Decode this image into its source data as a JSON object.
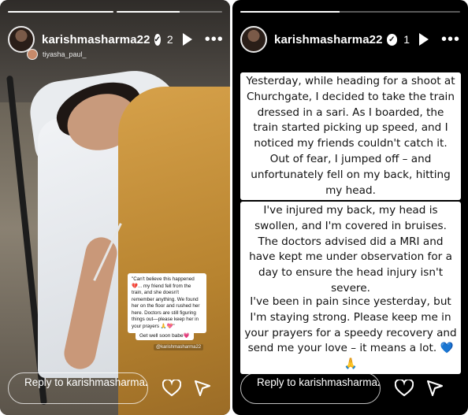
{
  "left_story": {
    "username": "karishmasharma22",
    "story_count": "2",
    "tagged_user": "tiyasha_paul_",
    "progress": [
      1.0,
      0.6
    ],
    "note_text": "\"Can't believe this happened 💔... my friend fell from the train, and she doesn't remember anything. We found her on the floor and rushed her here. Doctors are still figuring things out—please keep her in your prayers 🙏💖\"",
    "sticker_text": "Get well soon babe💗",
    "mention_text": "@karishmasharma22",
    "reply_placeholder": "Reply to karishmasharma22...",
    "icons": [
      "verified-icon",
      "play-icon",
      "more-icon",
      "heart-icon",
      "send-icon"
    ]
  },
  "right_story": {
    "username": "karishmasharma22",
    "story_count": "1",
    "progress": [
      0.45
    ],
    "paragraphs": [
      "Yesterday, while heading for a shoot at Churchgate, I decided to take the train dressed in a sari. As I boarded, the train started picking up speed, and I noticed my friends couldn't catch it. Out of fear, I jumped off – and unfortunately fell on my back, hitting my head.",
      "I've injured my back, my head is swollen, and I'm covered in bruises. The doctors advised did a MRI and have kept me under observation for a day to ensure the head injury isn't severe.",
      "I've been in pain since yesterday, but I'm staying strong. Please keep me in your prayers for a speedy recovery and send me your love – it means a lot. 💙🙏"
    ],
    "reply_placeholder": "Reply to karishmasharma22...",
    "icons": [
      "verified-icon",
      "play-icon",
      "more-icon",
      "heart-icon",
      "send-icon"
    ]
  },
  "colors": {
    "background": "#000000",
    "text_box": "#ffffff",
    "blanket": "#c8923d"
  }
}
